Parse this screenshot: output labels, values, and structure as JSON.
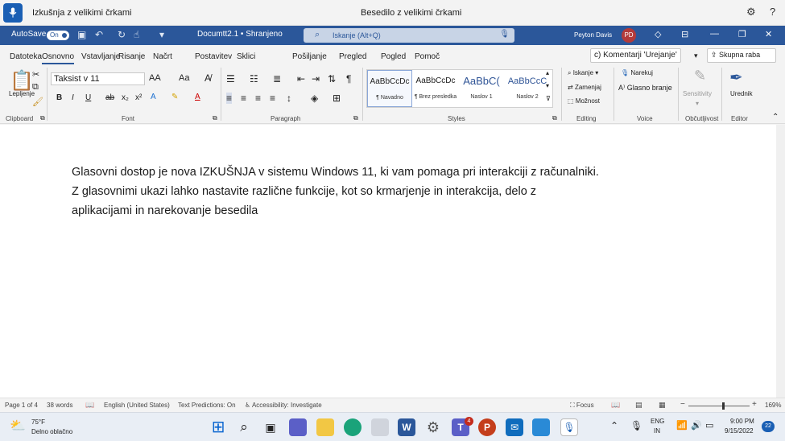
{
  "voice_bar": {
    "status": "Izkušnja z velikimi črkami",
    "center_text": "Besedilo z velikimi črkami",
    "settings_icon": "gear-icon",
    "help_icon": "question-icon"
  },
  "titlebar": {
    "autosave_label": "AutoSave",
    "autosave_state": "On",
    "doc_title": "Documtt2.1 • Shranjeno",
    "search_placeholder": "Iskanje (Alt+Q)",
    "user_name": "Peyton Davis",
    "user_initials": "PD"
  },
  "tabs": {
    "items": [
      "Datoteka",
      "Osnovno",
      "Vstavljanje",
      "Risanje",
      "Načrt",
      "Postavitev",
      "Sklici",
      "Pošiljanje",
      "Pregled",
      "Pogled",
      "Pomoč"
    ],
    "active": "Osnovno",
    "comments_label": "c) Komentarji 'Urejanje'",
    "share_label": "Skupna raba"
  },
  "ribbon": {
    "clipboard": {
      "paste_label": "Lepljenje",
      "group_label": "Clipboard"
    },
    "font": {
      "font_name": "Taksist v 11",
      "group_label": "Font",
      "grow": "AA",
      "case": "Aa",
      "bold": "B",
      "italic": "I",
      "underline": "U",
      "strike": "ab",
      "sub": "x₂",
      "sup": "x²",
      "color": "A"
    },
    "paragraph": {
      "group_label": "Paragraph"
    },
    "styles": {
      "group_label": "Styles",
      "items": [
        {
          "preview": "AaBbCcDc",
          "name": "¶ Navadno"
        },
        {
          "preview": "AaBbCcDc",
          "name": "¶ Brez presledka"
        },
        {
          "preview": "AaBbC(",
          "name": "Naslov 1"
        },
        {
          "preview": "AaBbCcC",
          "name": "Naslov 2"
        }
      ]
    },
    "editing": {
      "group_label": "Editing",
      "find": "Iskanje",
      "replace": "Zamenjaj",
      "select": "Možnost"
    },
    "voice": {
      "group_label": "Voice",
      "dictate": "Narekuj",
      "read_aloud": "Glasno branje"
    },
    "sensitivity": {
      "group_label": "Občutljivost",
      "label": "Sensitivity"
    },
    "editor": {
      "group_label": "Editor",
      "label": "Urednik"
    }
  },
  "document": {
    "lines": [
      "Glasovni dostop je nova IZKUŠNJA v sistemu Windows 11, ki vam pomaga pri interakciji z računalniki.",
      "Z glasovnimi ukazi lahko nastavite različne funkcije, kot so krmarjenje in interakcija, delo z",
      "aplikacijami in narekovanje besedila"
    ]
  },
  "status_bar": {
    "page": "Page 1 of 4",
    "words": "38 words",
    "language": "English (United States)",
    "predictions": "Text Predictions: On",
    "accessibility": "Accessibility: Investigate",
    "focus": "Focus",
    "zoom": "169%"
  },
  "taskbar": {
    "weather_temp": "75°F",
    "weather_desc": "Delno oblačno",
    "lang_top": "ENG",
    "lang_bottom": "IN",
    "time": "9:00 PM",
    "date": "9/15/2022",
    "notif_count": "22",
    "teams_badge": "4"
  },
  "colors": {
    "word_blue": "#2b579a",
    "voice_blue": "#1a5fb4"
  }
}
